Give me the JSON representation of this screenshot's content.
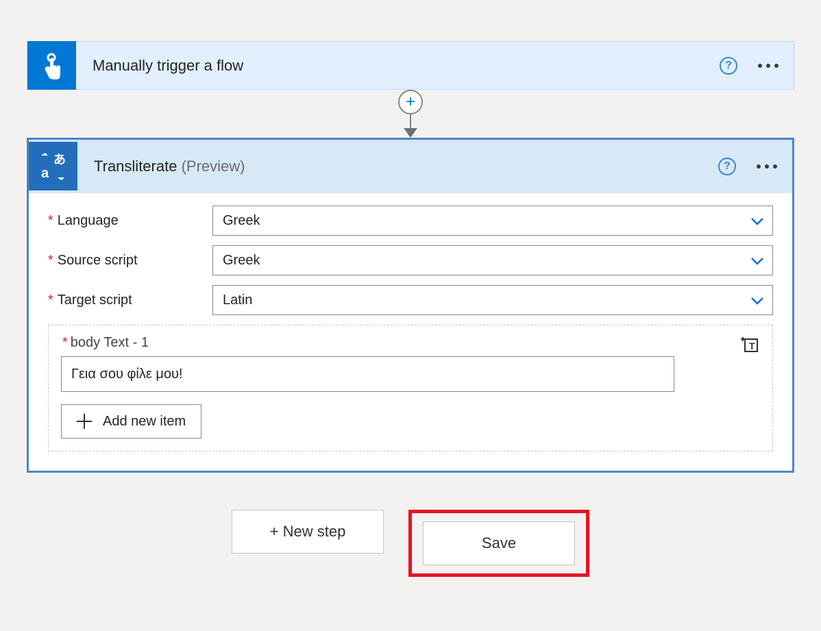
{
  "trigger": {
    "title": "Manually trigger a flow"
  },
  "action": {
    "title": "Transliterate",
    "suffix": "(Preview)",
    "fields": {
      "language": {
        "label": "Language",
        "value": "Greek"
      },
      "source_script": {
        "label": "Source script",
        "value": "Greek"
      },
      "target_script": {
        "label": "Target script",
        "value": "Latin"
      }
    },
    "body": {
      "label": "body Text - 1",
      "value": "Γεια σου φίλε μου!"
    },
    "add_item_label": "Add new item"
  },
  "buttons": {
    "new_step": "+ New step",
    "save": "Save"
  }
}
